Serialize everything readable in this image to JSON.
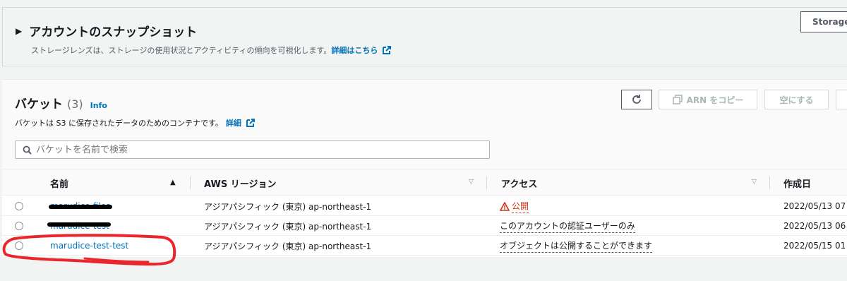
{
  "snapshot": {
    "title": "アカウントのスナップショット",
    "description": "ストレージレンズは、ストレージの使用状況とアクティビティの傾向を可視化します。",
    "details_link": "詳細はこちら",
    "storage_button": "Storage"
  },
  "buckets": {
    "title": "バケット",
    "count": "(3)",
    "info": "Info",
    "description": "バケットは S3 に保存されたデータのためのコンテナです。",
    "details_link": "詳細",
    "search_placeholder": "バケットを名前で検索",
    "buttons": {
      "copy_arn": "ARN をコピー",
      "empty": "空にする"
    },
    "columns": {
      "name": "名前",
      "region": "AWS リージョン",
      "access": "アクセス",
      "created": "作成日"
    },
    "rows": [
      {
        "name": "marudice-files",
        "region": "アジアパシフィック (東京) ap-northeast-1",
        "access": "公開",
        "created": "2022/05/13 07"
      },
      {
        "name": "marudice-test",
        "region": "アジアパシフィック (東京) ap-northeast-1",
        "access": "このアカウントの認証ユーザーのみ",
        "created": "2022/05/13 06"
      },
      {
        "name": "marudice-test-test",
        "region": "アジアパシフィック (東京) ap-northeast-1",
        "access": "オブジェクトは公開することができます",
        "created": "2022/05/15 01"
      }
    ]
  },
  "colors": {
    "link": "#0073bb",
    "warning": "#d13212",
    "annotation": "#e8262c"
  }
}
